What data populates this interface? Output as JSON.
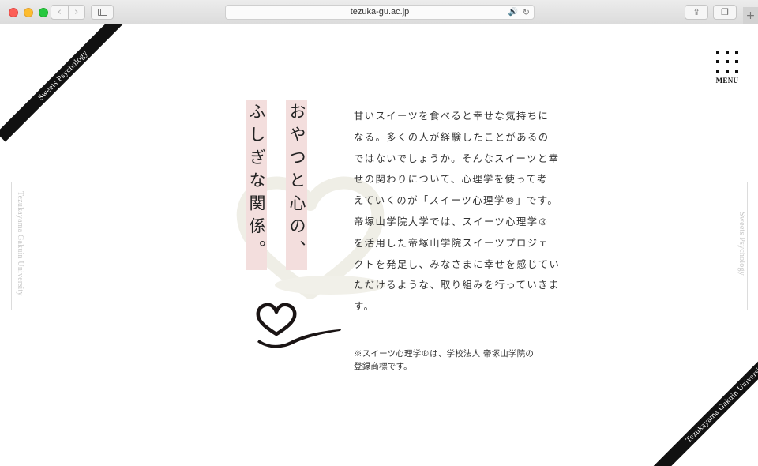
{
  "browser": {
    "url": "tezuka-gu.ac.jp",
    "back_icon": "‹",
    "forward_icon": "›",
    "share_icon": "⇪",
    "tabs_icon": "❐",
    "new_tab_icon": "+",
    "speaker_icon": "🔊",
    "reload_icon": "↻"
  },
  "corner_top_left": {
    "text": "Sweets Psychology"
  },
  "corner_bottom_right": {
    "text": "Tezukayama Gakuin University"
  },
  "side_left": {
    "text": "Tezukayama Gakuin University"
  },
  "side_right": {
    "text": "Sweets Psychology"
  },
  "menu": {
    "label": "MENU"
  },
  "title": {
    "line1": "おやつと心の、",
    "line2": "ふしぎな関係。"
  },
  "body": {
    "lines": [
      "甘いスイーツを食べると幸せな気持ちに",
      "なる。多くの人が経験したことがあるの",
      "ではないでしょうか。そんなスイーツと幸",
      "せの関わりについて、心理学を使って考",
      "えていくのが「スイーツ心理学®」です。",
      "帝塚山学院大学では、スイーツ心理学®",
      "を活用した帝塚山学院スイーツプロジェ",
      "クトを発足し、みなさまに幸せを感じてい",
      "ただけるような、取り組みを行っていきま",
      "す。"
    ]
  },
  "note": {
    "lines": [
      "※スイーツ心理学®は、学校法人 帝塚山学院の",
      "登録商標です。"
    ]
  },
  "colors": {
    "title_highlight": "#f3dedd",
    "heart_bg": "#efeee6",
    "band": "#111111",
    "spoon": "#1a1414"
  },
  "icons": {
    "menu": "grid-dots-icon",
    "heart": "heart-illustration",
    "spoon": "heart-spoon-illustration"
  }
}
